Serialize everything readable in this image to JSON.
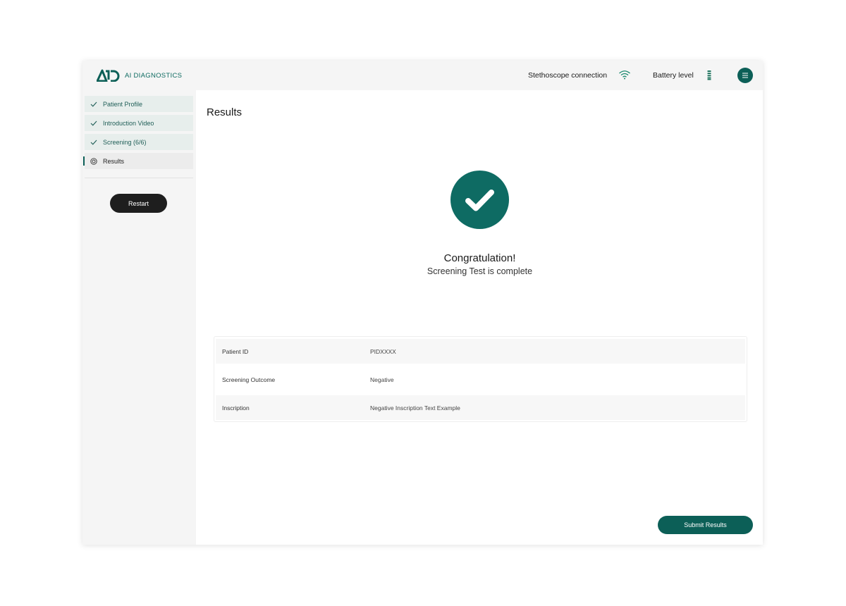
{
  "header": {
    "brand": "AI DIAGNOSTICS",
    "stethoscope_label": "Stethoscope connection",
    "battery_label": "Battery level"
  },
  "sidebar": {
    "items": [
      {
        "label": "Patient Profile",
        "status": "complete",
        "icon": "check-icon"
      },
      {
        "label": "Introduction Video",
        "status": "complete",
        "icon": "check-icon"
      },
      {
        "label": "Screening (6/6)",
        "status": "complete",
        "icon": "check-icon"
      },
      {
        "label": "Results",
        "status": "active",
        "icon": "target-icon"
      }
    ],
    "restart_label": "Restart"
  },
  "main": {
    "title": "Results",
    "congrats_title": "Congratulation!",
    "congrats_subtitle": "Screening Test is complete",
    "table": [
      {
        "key": "Patient ID",
        "value": "PIDXXXX"
      },
      {
        "key": "Screening Outcome",
        "value": "Negative"
      },
      {
        "key": "Inscription",
        "value": "Negative Inscription Text Example"
      }
    ],
    "submit_label": "Submit Results"
  },
  "colors": {
    "accent": "#0c5f57",
    "success": "#0e6b63",
    "sidebar_bg": "#f5f5f5",
    "dark_button": "#1e1e1e"
  }
}
